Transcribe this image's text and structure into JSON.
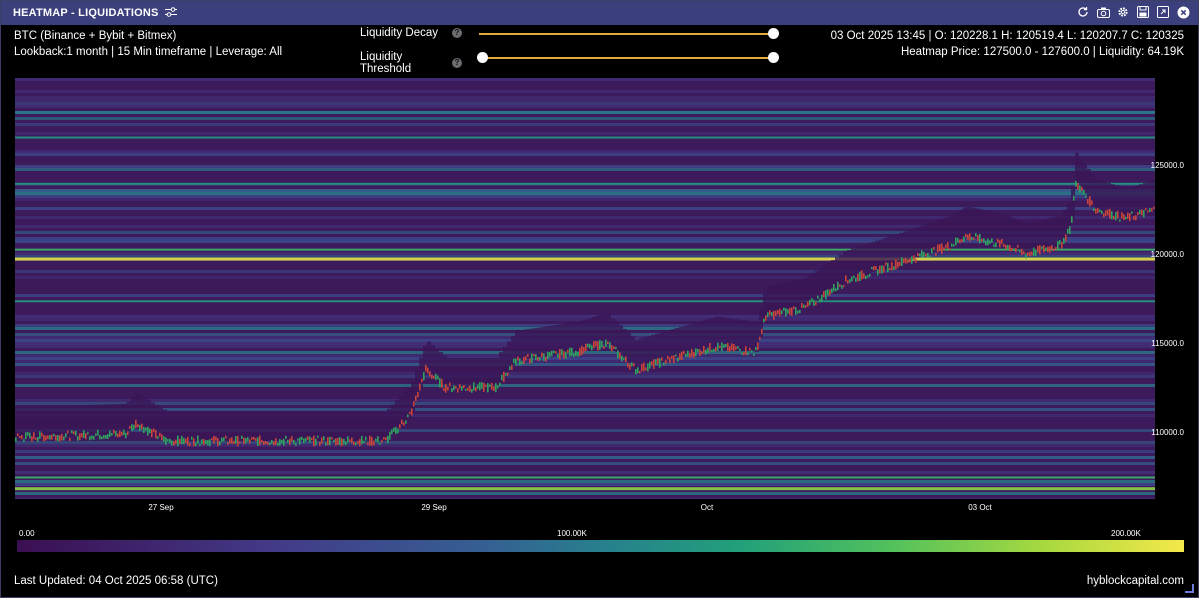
{
  "window": {
    "title": "HEATMAP - LIQUIDATIONS",
    "buttons": [
      "refresh-icon",
      "camera-icon",
      "gear-icon",
      "save-icon",
      "expand-icon",
      "close-icon"
    ]
  },
  "info": {
    "symbol": "BTC (Binance + Bybit + Bitmex)",
    "lookback": "Lookback:1 month | 15 Min timeframe | Leverage: All",
    "ohlc": "03 Oct 2025 13:45 | O: 120228.1 H: 120519.4 L: 120207.7 C: 120325",
    "heatmap_price": "Heatmap Price: 127500.0 - 127600.0 | Liquidity: 64.19K"
  },
  "controls": {
    "liquidity_decay_label": "Liquidity Decay",
    "liquidity_threshold_label": "Liquidity Threshold",
    "help_glyph": "?"
  },
  "chart": {
    "y_ticks": [
      {
        "label": "125000.0",
        "value": 125000
      },
      {
        "label": "120000.0",
        "value": 120000
      },
      {
        "label": "115000.0",
        "value": 115000
      },
      {
        "label": "110000.0",
        "value": 110000
      }
    ],
    "x_ticks": [
      "27 Sep",
      "29 Sep",
      "Oct",
      "03 Oct"
    ],
    "colors": {
      "low": "#3b0f52",
      "mid": "#277f8d",
      "high": "#f4e84a",
      "candle_up": "#2ea35f",
      "candle_down": "#c8443b"
    }
  },
  "colorbar": {
    "min_label": "0.00",
    "mid_label": "100.00K",
    "max_label": "200.00K"
  },
  "footer": {
    "last_updated": "Last Updated: 04 Oct 2025 06:58 (UTC)",
    "brand": "hyblockcapital.com"
  }
}
